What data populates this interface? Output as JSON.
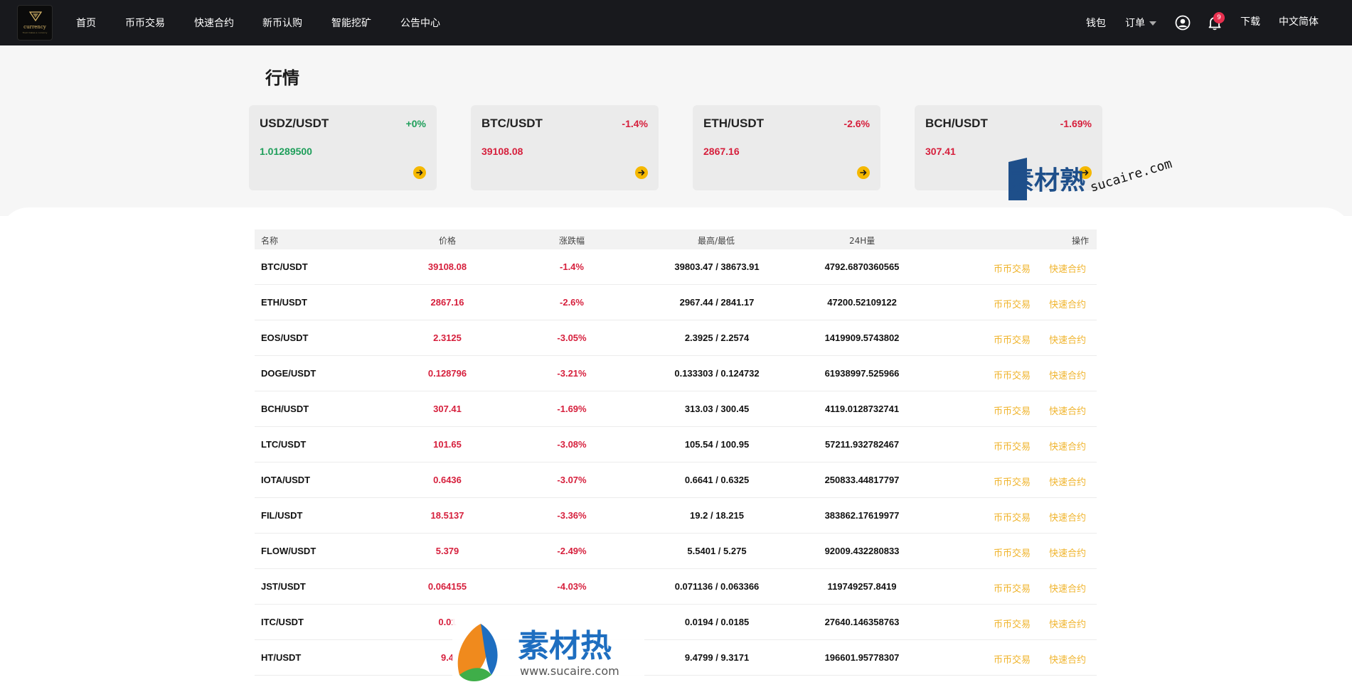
{
  "header": {
    "logo": {
      "brand": "currency",
      "tagline": "Trust makes a currency"
    },
    "nav": [
      "首页",
      "币币交易",
      "快速合约",
      "新币认购",
      "智能挖矿",
      "公告中心"
    ],
    "wallet": "钱包",
    "orders": "订单",
    "notification_count": "9",
    "download": "下载",
    "language": "中文简体",
    "icons": [
      "user-circle-icon",
      "bell-icon",
      "chevron-down-icon"
    ]
  },
  "market": {
    "title": "行情",
    "cards": [
      {
        "pair": "USDZ/USDT",
        "change": "+0%",
        "price": "1.01289500",
        "trend": "up"
      },
      {
        "pair": "BTC/USDT",
        "change": "-1.4%",
        "price": "39108.08",
        "trend": "down"
      },
      {
        "pair": "ETH/USDT",
        "change": "-2.6%",
        "price": "2867.16",
        "trend": "down"
      },
      {
        "pair": "BCH/USDT",
        "change": "-1.69%",
        "price": "307.41",
        "trend": "down"
      }
    ]
  },
  "table": {
    "columns": [
      "名称",
      "价格",
      "涨跌幅",
      "最高/最低",
      "24H量",
      "操作"
    ],
    "action_spot": "币币交易",
    "action_contract": "快速合约",
    "rows": [
      {
        "name": "BTC/USDT",
        "price": "39108.08",
        "change": "-1.4%",
        "high_low": "39803.47 / 38673.91",
        "volume": "4792.6870360565"
      },
      {
        "name": "ETH/USDT",
        "price": "2867.16",
        "change": "-2.6%",
        "high_low": "2967.44 / 2841.17",
        "volume": "47200.52109122"
      },
      {
        "name": "EOS/USDT",
        "price": "2.3125",
        "change": "-3.05%",
        "high_low": "2.3925 / 2.2574",
        "volume": "1419909.5743802"
      },
      {
        "name": "DOGE/USDT",
        "price": "0.128796",
        "change": "-3.21%",
        "high_low": "0.133303 / 0.124732",
        "volume": "61938997.525966"
      },
      {
        "name": "BCH/USDT",
        "price": "307.41",
        "change": "-1.69%",
        "high_low": "313.03 / 300.45",
        "volume": "4119.0128732741"
      },
      {
        "name": "LTC/USDT",
        "price": "101.65",
        "change": "-3.08%",
        "high_low": "105.54 / 100.95",
        "volume": "57211.932782467"
      },
      {
        "name": "IOTA/USDT",
        "price": "0.6436",
        "change": "-3.07%",
        "high_low": "0.6641 / 0.6325",
        "volume": "250833.44817797"
      },
      {
        "name": "FIL/USDT",
        "price": "18.5137",
        "change": "-3.36%",
        "high_low": "19.2 / 18.215",
        "volume": "383862.17619977"
      },
      {
        "name": "FLOW/USDT",
        "price": "5.379",
        "change": "-2.49%",
        "high_low": "5.5401 / 5.275",
        "volume": "92009.432280833"
      },
      {
        "name": "JST/USDT",
        "price": "0.064155",
        "change": "-4.03%",
        "high_low": "0.071136 / 0.063366",
        "volume": "119749257.8419"
      },
      {
        "name": "ITC/USDT",
        "price": "0.01",
        "change": "",
        "high_low": "0.0194 / 0.0185",
        "volume": "27640.146358763"
      },
      {
        "name": "HT/USDT",
        "price": "9.4",
        "change": "",
        "high_low": "9.4799 / 9.3171",
        "volume": "196601.95778307"
      }
    ]
  },
  "watermark": {
    "logo_text": "素材熟",
    "domain_text": "sucaire.com",
    "logo_text_2": "素材热",
    "domain_text_2": "www.sucaire.com"
  },
  "colors": {
    "up": "#1e9e5a",
    "down": "#d61f3c",
    "action": "#f0b42c",
    "nav_bg": "#18191d",
    "card_arrow": "#f5b800"
  }
}
